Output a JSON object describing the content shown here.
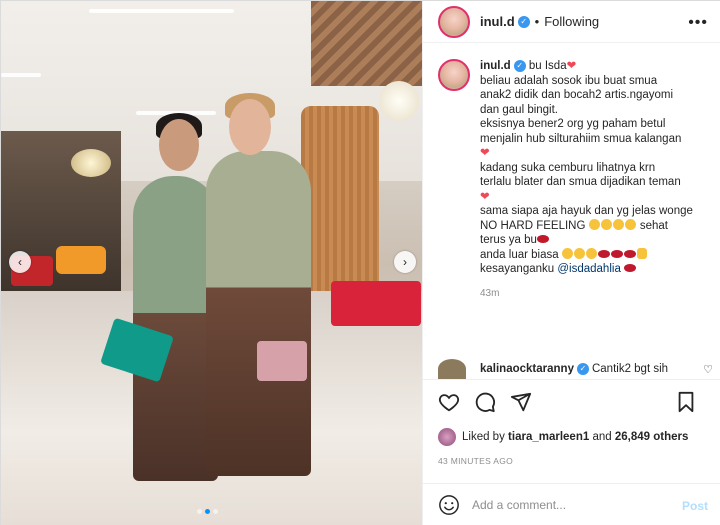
{
  "post": {
    "username": "inul.d",
    "follow_status": "Following",
    "separator": "•",
    "more_icon": "•••"
  },
  "caption": {
    "username": "inul.d",
    "lines": [
      "bu Isda",
      "beliau adalah sosok ibu buat smua",
      "anak2 didik dan bocah2 artis.ngayomi",
      "dan gaul bingit.",
      "eksisnya bener2 org yg paham betul",
      "menjalin hub silturahiim smua kalangan",
      "kadang suka cemburu lihatnya krn",
      "terlalu blater dan smua dijadikan teman",
      "sama siapa aja hayuk dan yg jelas wonge",
      "NO HARD FEELING",
      "sehat",
      "terus ya bu",
      "anda luar biasa",
      "kesayanganku",
      "@isdadahlia"
    ],
    "time": "43m"
  },
  "comment": {
    "username": "kalinaocktaranny",
    "text": "Cantik2 bgt sih"
  },
  "likes": {
    "prefix": "Liked by",
    "user": "tiara_marleen1",
    "connector": "and",
    "count": "26,849 others"
  },
  "timestamp": "43 MINUTES AGO",
  "add_comment": {
    "placeholder": "Add a comment...",
    "post_label": "Post"
  },
  "carousel": {
    "prev_label": "‹",
    "next_label": "›",
    "dots": 3,
    "active_dot": 1
  },
  "colors": {
    "accent": "#0095f6",
    "verified": "#3897f0",
    "heart": "#ed4956",
    "mention": "#00376b",
    "post_disabled": "#b2dffc"
  },
  "icons": [
    "more-icon",
    "verified-icon",
    "heart-icon",
    "comment-icon",
    "share-icon",
    "bookmark-icon",
    "smile-icon",
    "chevron-left-icon",
    "chevron-right-icon"
  ]
}
